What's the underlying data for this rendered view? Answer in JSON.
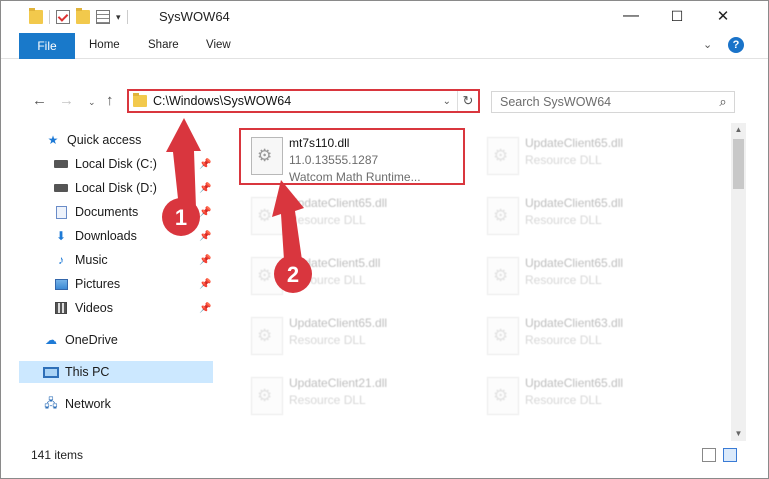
{
  "window": {
    "title": "SysWOW64",
    "controls": {
      "minimize": "—",
      "maximize": "☐",
      "close": "✕"
    }
  },
  "ribbon": {
    "file_tab": "File",
    "tabs": [
      "Home",
      "Share",
      "View"
    ],
    "help": "?"
  },
  "address_bar": {
    "path": "C:\\Windows\\SysWOW64",
    "search_placeholder": "Search SysWOW64"
  },
  "nav_pane": {
    "items": [
      {
        "label": "Quick access",
        "icon": "star-icon",
        "pinned": false
      },
      {
        "label": "Local Disk (C:)",
        "icon": "drive-icon",
        "pinned": true
      },
      {
        "label": "Local Disk (D:)",
        "icon": "drive-icon",
        "pinned": true
      },
      {
        "label": "Documents",
        "icon": "documents-icon",
        "pinned": true
      },
      {
        "label": "Downloads",
        "icon": "download-icon",
        "pinned": true
      },
      {
        "label": "Music",
        "icon": "music-icon",
        "pinned": true
      },
      {
        "label": "Pictures",
        "icon": "pictures-icon",
        "pinned": true
      },
      {
        "label": "Videos",
        "icon": "videos-icon",
        "pinned": true
      },
      {
        "label": "OneDrive",
        "icon": "cloud-icon",
        "pinned": false
      },
      {
        "label": "This PC",
        "icon": "computer-icon",
        "pinned": false,
        "selected": true
      },
      {
        "label": "Network",
        "icon": "network-icon",
        "pinned": false
      }
    ]
  },
  "files": [
    {
      "name": "mt7s110.dll",
      "line2": "11.0.13555.1287",
      "line3": "Watcom Math Runtime...",
      "highlighted": true
    },
    {
      "name": "UpdateClient65.dll",
      "line2": "Resource DLL"
    },
    {
      "name": "UpdateClient65.dll",
      "line2": "Resource DLL"
    },
    {
      "name": "UpdateClient65.dll",
      "line2": "Resource DLL"
    },
    {
      "name": "UpdateClient5.dll",
      "line2": "Resource DLL"
    },
    {
      "name": "UpdateClient65.dll",
      "line2": "Resource DLL"
    },
    {
      "name": "UpdateClient65.dll",
      "line2": "Resource DLL"
    },
    {
      "name": "UpdateClient63.dll",
      "line2": "Resource DLL"
    },
    {
      "name": "UpdateClient21.dll",
      "line2": "Resource DLL"
    },
    {
      "name": "UpdateClient65.dll",
      "line2": "Resource DLL"
    }
  ],
  "status_bar": {
    "item_count": "141 items"
  },
  "annotations": {
    "badge1": "1",
    "badge2": "2",
    "color": "#d9363e"
  }
}
